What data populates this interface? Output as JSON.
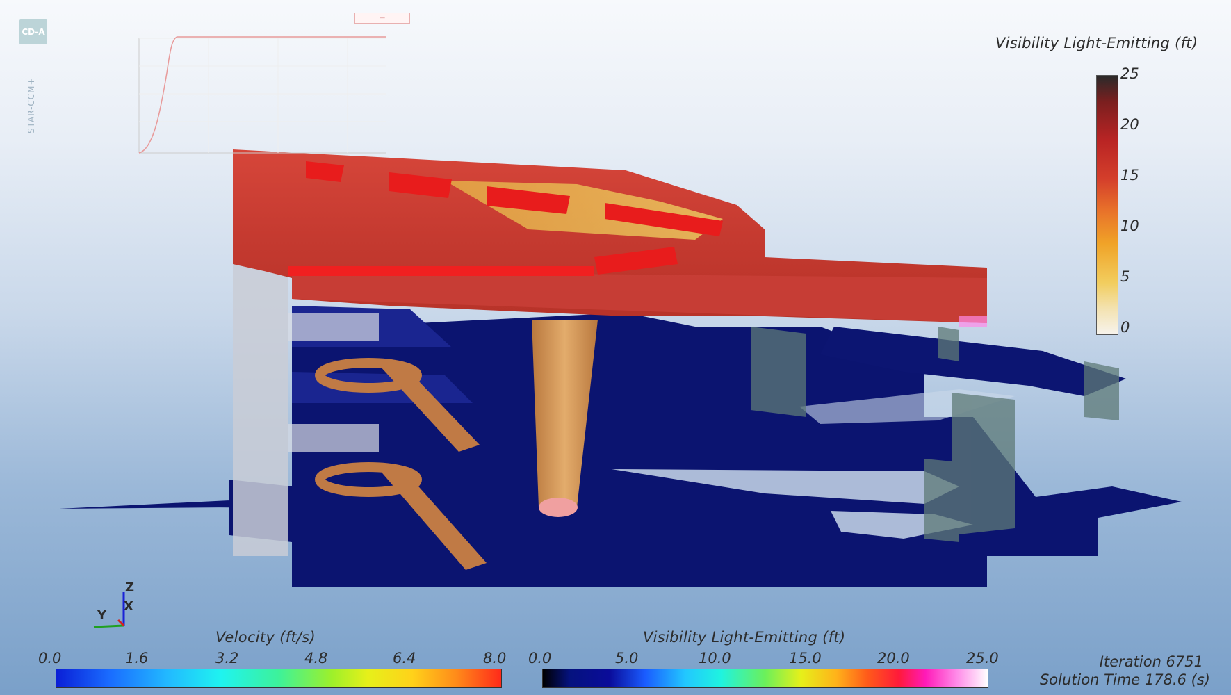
{
  "logo": {
    "badge": "CD-A",
    "product": "STAR-CCM+"
  },
  "vis_colorbar": {
    "title": "Visibility Light-Emitting (ft)",
    "ticks": [
      "25",
      "20",
      "15",
      "10",
      "5",
      "0"
    ]
  },
  "velocity_colorbar": {
    "title": "Velocity (ft/s)",
    "ticks": [
      "0.0",
      "1.6",
      "3.2",
      "4.8",
      "6.4",
      "8.0"
    ]
  },
  "vis_h_colorbar": {
    "title": "Visibility Light-Emitting (ft)",
    "ticks": [
      "0.0",
      "5.0",
      "10.0",
      "15.0",
      "20.0",
      "25.0"
    ]
  },
  "status": {
    "iteration": "Iteration 6751",
    "solution_time": "Solution Time 178.6 (s)"
  },
  "axes": {
    "z": "Z",
    "y": "Y",
    "x": "X"
  },
  "colors": {
    "smoke_layer": "#c8322a",
    "floor": "#0b1470",
    "plume": "#d89a5a",
    "wood": "#c07a45"
  }
}
